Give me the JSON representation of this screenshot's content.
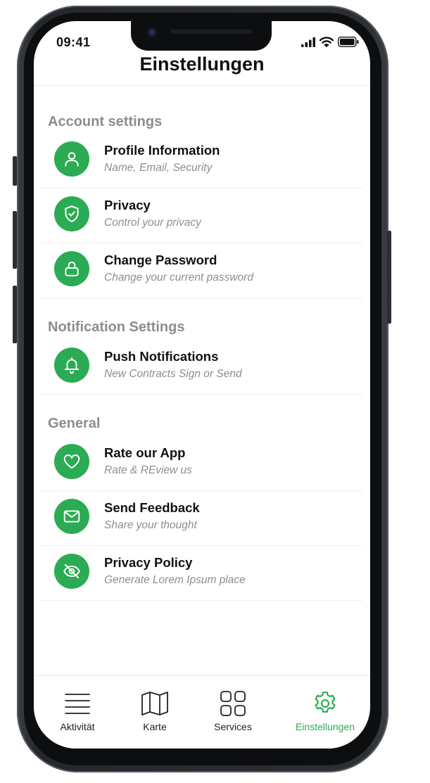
{
  "status_bar": {
    "time": "09:41"
  },
  "header": {
    "title": "Einstellungen"
  },
  "sections": [
    {
      "title": "Account settings",
      "items": [
        {
          "label": "Profile Information",
          "subtitle": "Name, Email, Security",
          "icon": "user-icon"
        },
        {
          "label": "Privacy",
          "subtitle": "Control your privacy",
          "icon": "shield-check-icon"
        },
        {
          "label": "Change Password",
          "subtitle": "Change your current password",
          "icon": "lock-icon"
        }
      ]
    },
    {
      "title": "Notification Settings",
      "items": [
        {
          "label": "Push Notifications",
          "subtitle": "New Contracts Sign or Send",
          "icon": "bell-icon"
        }
      ]
    },
    {
      "title": "General",
      "items": [
        {
          "label": "Rate our App",
          "subtitle": "Rate & REview us",
          "icon": "heart-icon"
        },
        {
          "label": "Send Feedback",
          "subtitle": "Share your thought",
          "icon": "mail-icon"
        },
        {
          "label": "Privacy Policy",
          "subtitle": "Generate Lorem Ipsum place",
          "icon": "eye-off-icon"
        }
      ]
    }
  ],
  "tabbar": {
    "tabs": [
      {
        "label": "Aktivität",
        "icon": "menu-icon",
        "active": false
      },
      {
        "label": "Karte",
        "icon": "map-icon",
        "active": false
      },
      {
        "label": "Services",
        "icon": "grid-icon",
        "active": false
      },
      {
        "label": "Einstellungen",
        "icon": "gear-icon",
        "active": true
      }
    ]
  },
  "colors": {
    "accent": "#2bab53",
    "section_title": "#8d8d8d",
    "subtitle": "#8e8e8e",
    "text": "#111111"
  }
}
